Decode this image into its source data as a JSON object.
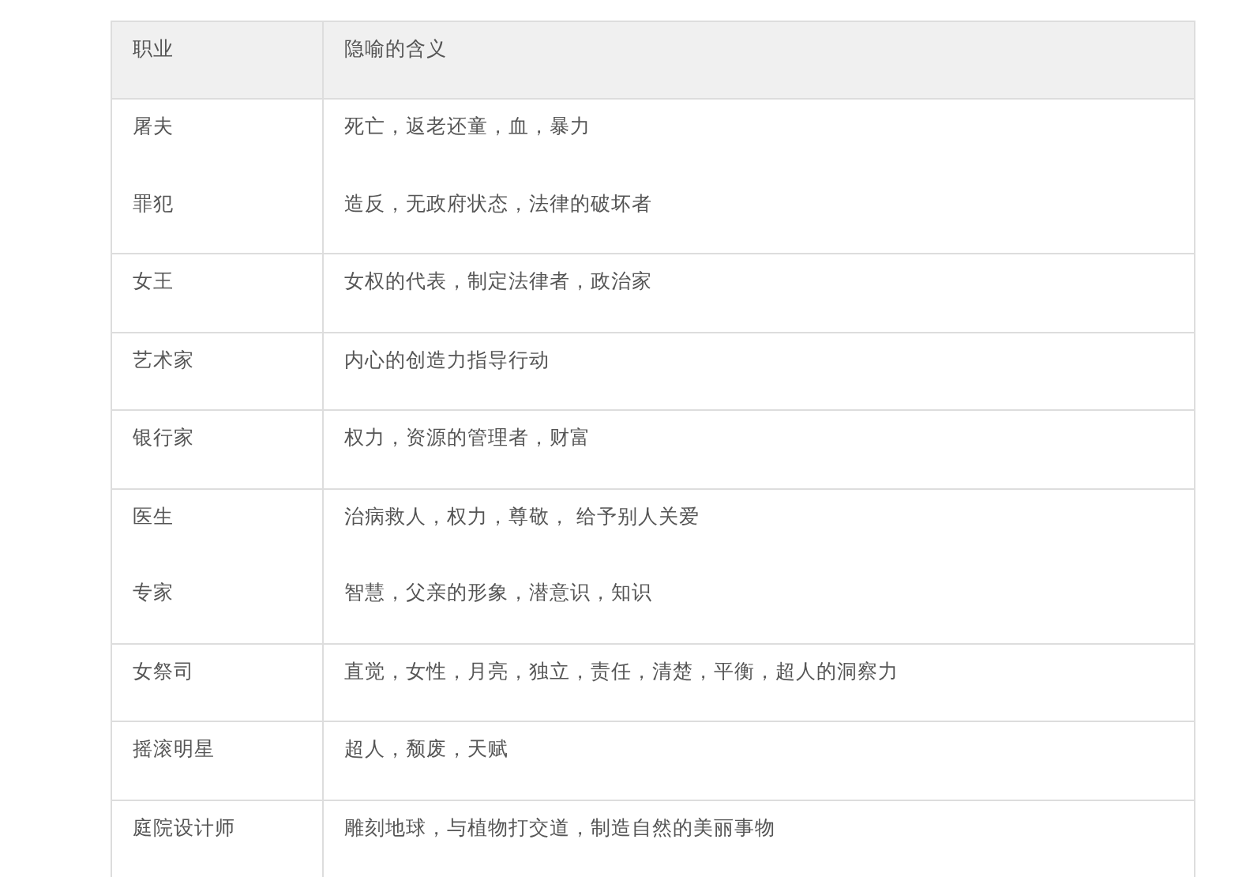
{
  "table": {
    "columns": [
      "职业",
      "隐喻的含义"
    ],
    "rows": [
      {
        "items": [
          {
            "job": "屠夫",
            "meaning": "死亡，返老还童，血，暴力"
          },
          {
            "job": "罪犯",
            "meaning": "造反，无政府状态，法律的破坏者"
          }
        ]
      },
      {
        "items": [
          {
            "job": "女王",
            "meaning": "女权的代表，制定法律者，政治家"
          }
        ]
      },
      {
        "items": [
          {
            "job": "艺术家",
            "meaning": "内心的创造力指导行动"
          }
        ]
      },
      {
        "items": [
          {
            "job": "银行家",
            "meaning": "权力，资源的管理者，财富"
          }
        ]
      },
      {
        "items": [
          {
            "job": "医生",
            "meaning": "治病救人，权力，尊敬， 给予别人关爱"
          },
          {
            "job": "专家",
            "meaning": "智慧，父亲的形象，潜意识，知识"
          }
        ]
      },
      {
        "items": [
          {
            "job": "女祭司",
            "meaning": "直觉，女性，月亮，独立，责任，清楚，平衡，超人的洞察力"
          }
        ]
      },
      {
        "items": [
          {
            "job": "摇滚明星",
            "meaning": "超人，颓废，天赋"
          }
        ]
      },
      {
        "items": [
          {
            "job": "庭院设计师",
            "meaning": "雕刻地球，与植物打交道，制造自然的美丽事物"
          }
        ]
      }
    ]
  }
}
